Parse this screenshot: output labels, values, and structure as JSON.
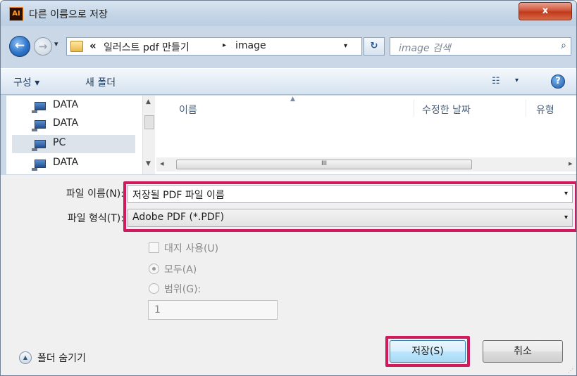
{
  "window": {
    "app_icon": "AI",
    "title": "다른 이름으로 저장",
    "close_label": "x"
  },
  "nav": {
    "back_icon": "←",
    "forward_icon": "→",
    "history_arrow": "▾",
    "address_chevron": "«",
    "address_segment_1": "일러스트 pdf 만들기",
    "address_separator": "▸",
    "address_segment_2": "image",
    "address_dropdown": "▾",
    "refresh_icon": "↻",
    "search_placeholder": "image 검색",
    "search_icon": "⌕"
  },
  "toolbar": {
    "organize_label": "구성 ▾",
    "new_folder_label": "새 폴더",
    "view_icon": "☷",
    "view_dropdown": "▾",
    "help_icon": "?"
  },
  "nav_pane": {
    "items": [
      {
        "label": "DATA",
        "selected": false
      },
      {
        "label": "DATA",
        "selected": false
      },
      {
        "label": "PC",
        "selected": true
      },
      {
        "label": "DATA",
        "selected": false
      }
    ]
  },
  "file_list": {
    "columns": [
      "이름",
      "수정한 날짜",
      "유형"
    ],
    "sort_indicator": "▲",
    "hscroll_thumb_grip": "III"
  },
  "form": {
    "filename_label": "파일 이름(N):",
    "filename_value": "저장될 PDF 파일 이름",
    "filetype_label": "파일 형식(T):",
    "filetype_value": "Adobe PDF (*.PDF)",
    "dropdown_arrow": "▾",
    "use_artboards_label": "대지 사용(U)",
    "all_label": "모두(A)",
    "range_label": "범위(G):",
    "range_value": "1"
  },
  "footer": {
    "hide_folders_label": "폴더 숨기기",
    "hide_folders_icon": "▲",
    "save_label": "저장(S)",
    "cancel_label": "취소"
  },
  "colors": {
    "highlight": "#d11a5e",
    "titlebar": "#c3d4e6",
    "close": "#c0391b"
  }
}
